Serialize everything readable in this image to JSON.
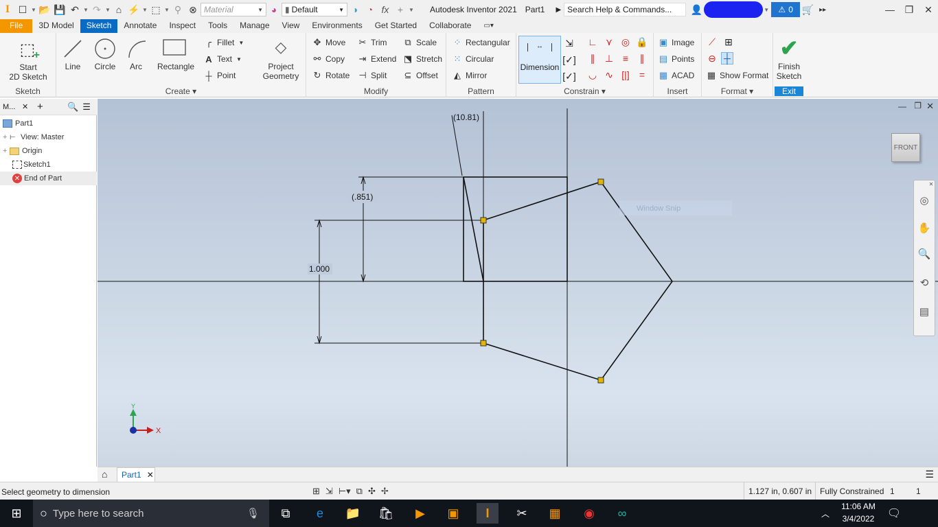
{
  "app": {
    "logo": "I",
    "title": "Autodesk Inventor 2021",
    "document": "Part1",
    "search_placeholder": "Search Help & Commands...",
    "alert_count": "0"
  },
  "quick_access": {
    "material_placeholder": "Material",
    "appearance_value": "Default",
    "fx_label": "fx"
  },
  "tabs": [
    "File",
    "3D Model",
    "Sketch",
    "Annotate",
    "Inspect",
    "Tools",
    "Manage",
    "View",
    "Environments",
    "Get Started",
    "Collaborate"
  ],
  "ribbon": {
    "sketch_panel": {
      "title": "Sketch",
      "start_label": "Start\n2D Sketch"
    },
    "create_panel": {
      "title": "Create",
      "line": "Line",
      "circle": "Circle",
      "arc": "Arc",
      "rectangle": "Rectangle",
      "fillet": "Fillet",
      "text": "Text",
      "point": "Point",
      "project_geometry": "Project\nGeometry"
    },
    "modify_panel": {
      "title": "Modify",
      "move": "Move",
      "trim": "Trim",
      "scale": "Scale",
      "copy": "Copy",
      "extend": "Extend",
      "stretch": "Stretch",
      "rotate": "Rotate",
      "split": "Split",
      "offset": "Offset"
    },
    "pattern_panel": {
      "title": "Pattern",
      "rectangular": "Rectangular",
      "circular": "Circular",
      "mirror": "Mirror"
    },
    "constrain_panel": {
      "title": "Constrain",
      "dimension": "Dimension"
    },
    "insert_panel": {
      "title": "Insert",
      "image": "Image",
      "points": "Points",
      "acad": "ACAD"
    },
    "format_panel": {
      "title": "Format",
      "show_format": "Show Format"
    },
    "exit_panel": {
      "title": "Exit",
      "finish": "Finish\nSketch"
    }
  },
  "browser": {
    "tab_label": "M...",
    "items": [
      {
        "label": "Part1",
        "indent": 0
      },
      {
        "label": "View: Master",
        "indent": 1
      },
      {
        "label": "Origin",
        "indent": 1
      },
      {
        "label": "Sketch1",
        "indent": 1
      },
      {
        "label": "End of Part",
        "indent": 1
      }
    ]
  },
  "viewport": {
    "viewcube_face": "FRONT",
    "snip_label": "Window Snip",
    "dimensions": {
      "angle": "(10.81)",
      "height_upper": "(.851)",
      "height_total": "1.000"
    },
    "axis": {
      "x": "X",
      "y": "Y"
    }
  },
  "doc_tabs": [
    {
      "label": "Part1"
    }
  ],
  "status": {
    "prompt": "Select geometry to dimension",
    "coords": "1.127 in, 0.607 in",
    "constraint_state": "Fully Constrained",
    "count_a": "1",
    "count_b": "1"
  },
  "taskbar": {
    "search_placeholder": "Type here to search",
    "time": "11:06 AM",
    "date": "3/4/2022"
  },
  "colors": {
    "accent": "#0a6bc4",
    "file_tab": "#f39600",
    "finish_check": "#2ea44f",
    "point": "#e3b600"
  }
}
